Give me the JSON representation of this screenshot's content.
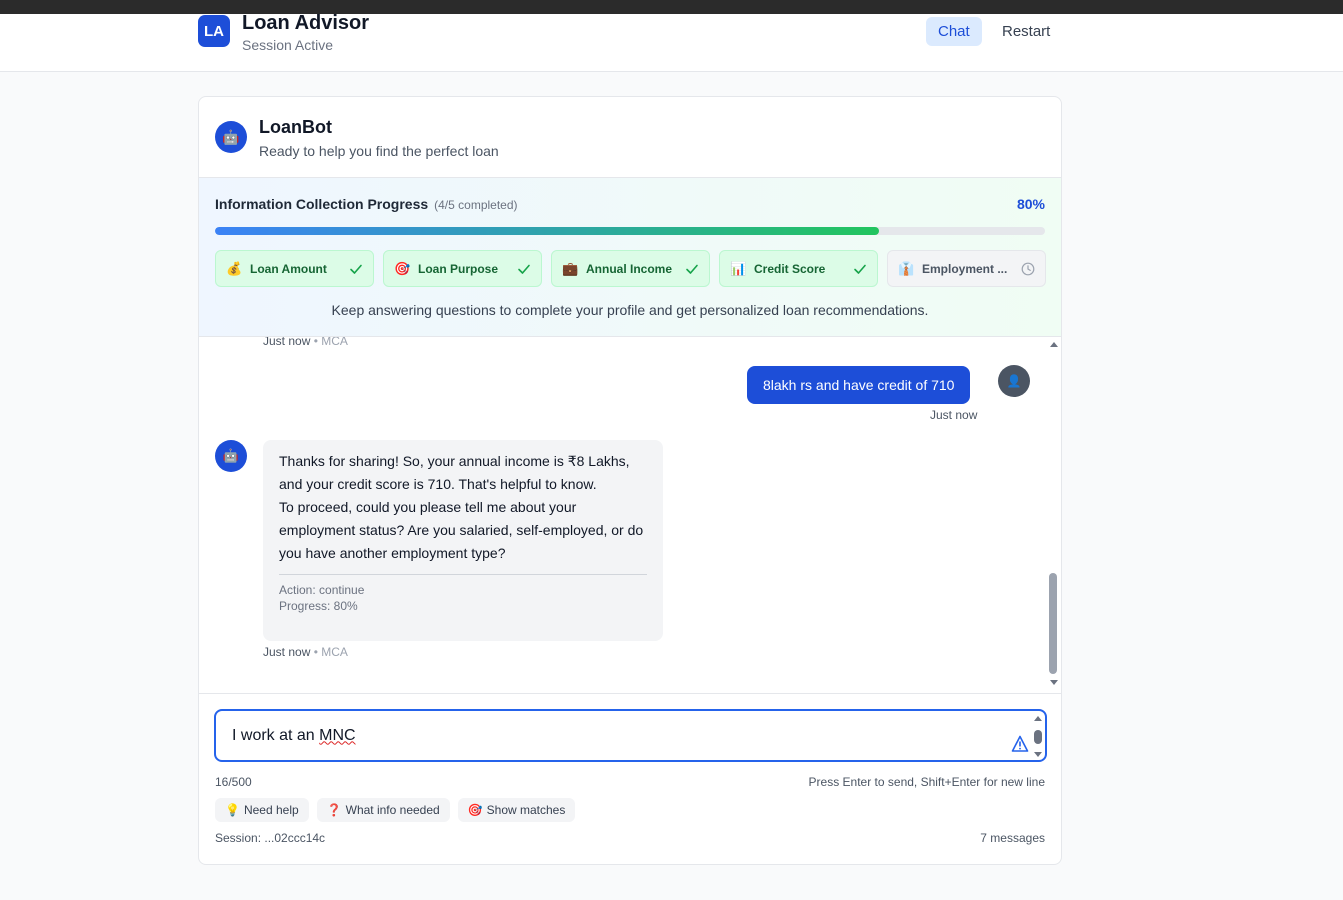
{
  "app": {
    "logo": "LA",
    "title": "Loan Advisor",
    "status": "Session Active",
    "nav": {
      "chat": "Chat",
      "restart": "Restart"
    }
  },
  "bot": {
    "avatar_icon": "robot-icon",
    "name": "LoanBot",
    "tagline": "Ready to help you find the perfect loan"
  },
  "progress": {
    "title": "Information Collection Progress",
    "count": "(4/5 completed)",
    "percent_label": "80%",
    "fraction": 0.8,
    "steps": [
      {
        "icon": "💰",
        "label": "Loan Amount",
        "done": true
      },
      {
        "icon": "🎯",
        "label": "Loan Purpose",
        "done": true
      },
      {
        "icon": "💼",
        "label": "Annual Income",
        "done": true
      },
      {
        "icon": "📊",
        "label": "Credit Score",
        "done": true
      },
      {
        "icon": "👔",
        "label": "Employment ...",
        "done": false
      }
    ],
    "hint": "Keep answering questions to complete your profile and get personalized loan recommendations."
  },
  "messages": {
    "prev_meta_time": "Just now",
    "prev_meta_model": "MCA",
    "user_message": "8lakh rs and have credit of 710",
    "user_time": "Just now",
    "bot_message": "Thanks for sharing! So, your annual income is ₹8 Lakhs, and your credit score is 710. That's helpful to know.\nTo proceed, could you please tell me about your employment status? Are you salaried, self-employed, or do you have another employment type?",
    "bot_action": "Action: continue",
    "bot_progress": "Progress: 80%",
    "bot_meta_time": "Just now",
    "bot_meta_model": "MCA",
    "separator": " • "
  },
  "composer": {
    "input_value_prefix": "I work at an ",
    "input_value_flagged": "MNC",
    "char_count": "16/500",
    "hint": "Press Enter to send, Shift+Enter for new line",
    "quick_actions": [
      {
        "icon": "💡",
        "label": "Need help"
      },
      {
        "icon": "❓",
        "label": "What info needed"
      },
      {
        "icon": "🎯",
        "label": "Show matches"
      }
    ],
    "session": "Session: ...02ccc14c",
    "message_count": "7 messages"
  },
  "colors": {
    "accent": "#1d4ed8",
    "success": "#16a34a",
    "pending": "#9ca3af"
  }
}
